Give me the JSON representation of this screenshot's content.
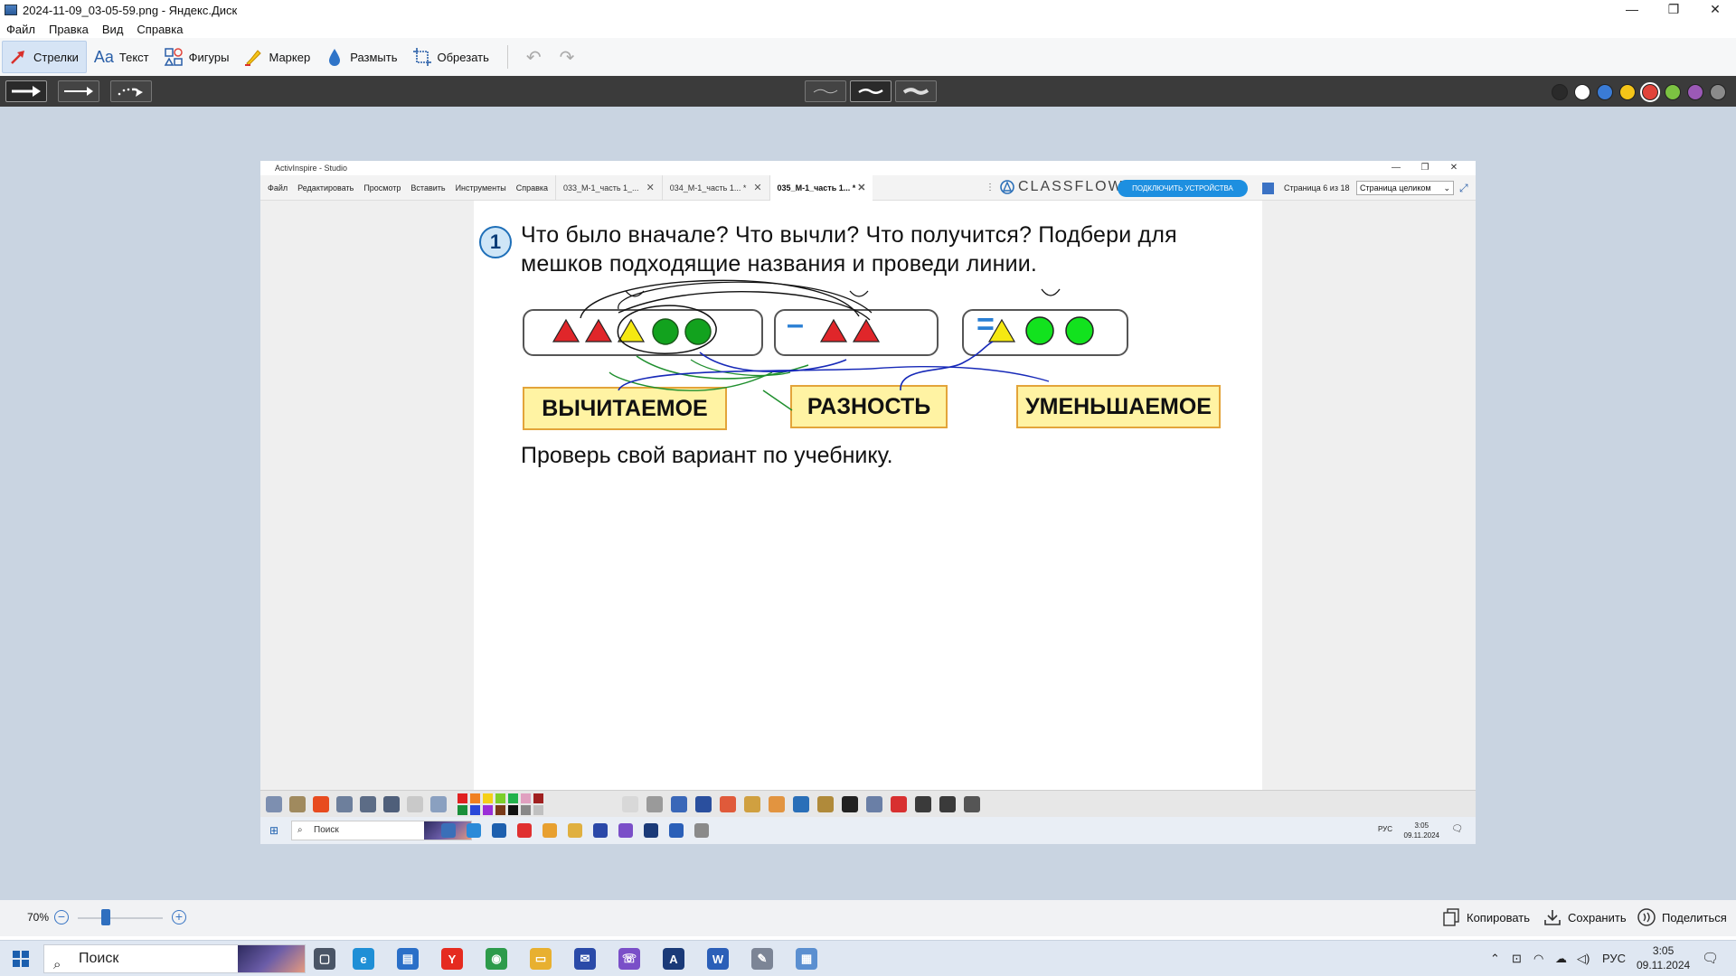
{
  "window": {
    "title": "2024-11-09_03-05-59.png - Яндекс.Диск",
    "controls": {
      "minimize": "—",
      "restore": "❐",
      "close": "✕"
    }
  },
  "menu": [
    "Файл",
    "Правка",
    "Вид",
    "Справка"
  ],
  "tools": [
    {
      "label": "Стрелки",
      "icon": "arrow-icon"
    },
    {
      "label": "Текст",
      "icon": "text-icon"
    },
    {
      "label": "Фигуры",
      "icon": "shapes-icon"
    },
    {
      "label": "Маркер",
      "icon": "marker-icon"
    },
    {
      "label": "Размыть",
      "icon": "blur-icon"
    },
    {
      "label": "Обрезать",
      "icon": "crop-icon"
    }
  ],
  "colors": {
    "swatches": [
      "#2a2a2a",
      "#ffffff",
      "#3a7bd5",
      "#f5c518",
      "#e0433a",
      "#7cc242",
      "#9b59b6",
      "#8a8a8a"
    ],
    "selected": "#e0433a"
  },
  "embedded": {
    "app_title": "ActivInspire - Studio",
    "menu": [
      "Файл",
      "Редактировать",
      "Просмотр",
      "Вставить",
      "Инструменты",
      "Справка"
    ],
    "tabs": [
      {
        "label": "033_М-1_часть 1_...",
        "close": "✕"
      },
      {
        "label": "034_М-1_часть 1... *",
        "close": "✕"
      },
      {
        "label": "035_М-1_часть 1... *",
        "close": "✕"
      }
    ],
    "classflow": "CLASSFLOW",
    "connect_button": "ПОДКЛЮЧИТЬ УСТРОЙСТВА",
    "page_info": "Страница 6 из 18",
    "fit_select": "Страница целиком",
    "task": {
      "number": "1",
      "line1": "Что было вначале? Что вычли? Что получится? Подбери для",
      "line2": "мешков подходящие названия и проведи линии.",
      "minus": "–",
      "equals": "=",
      "labels": [
        "ВЫЧИТАЕМОЕ",
        "РАЗНОСТЬ",
        "УМЕНЬШАЕМОЕ"
      ],
      "check": "Проверь свой вариант по учебнику."
    },
    "taskbar": {
      "search": "Поиск",
      "lang": "РУС",
      "time": "3:05",
      "date": "09.11.2024"
    }
  },
  "status": {
    "zoom": "70%",
    "copy": "Копировать",
    "save": "Сохранить",
    "share": "Поделиться"
  },
  "taskbar": {
    "search": "Поиск",
    "lang": "РУС",
    "time": "3:05",
    "date": "09.11.2024"
  }
}
